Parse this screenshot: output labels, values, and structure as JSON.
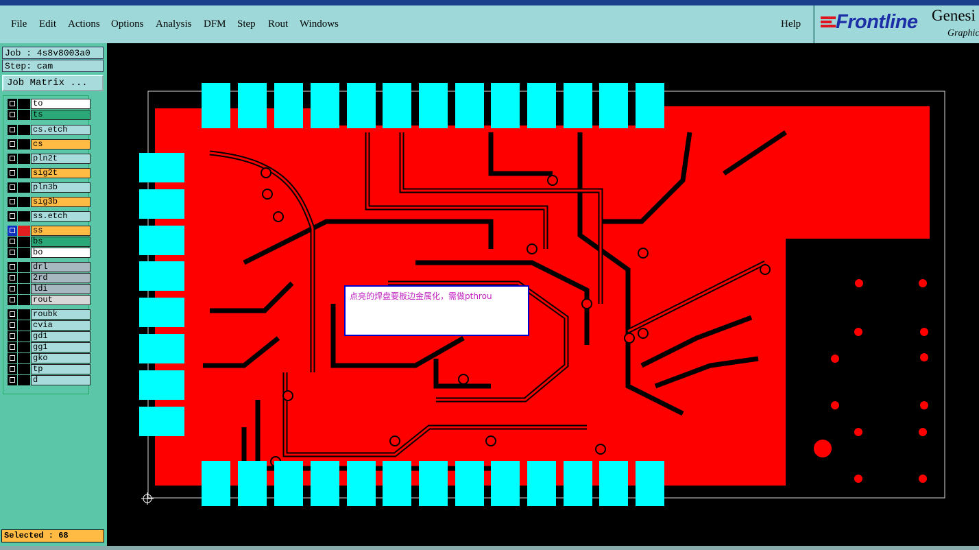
{
  "menu": {
    "items": [
      "File",
      "Edit",
      "Actions",
      "Options",
      "Analysis",
      "DFM",
      "Step",
      "Rout",
      "Windows"
    ],
    "help": "Help"
  },
  "logo": {
    "brand": "Frontline",
    "product": "Genesi",
    "sub": "Graphic"
  },
  "job": {
    "label": "Job : 4s8v8003a0",
    "step": "Step: cam",
    "matrix_button": "Job Matrix ..."
  },
  "layers": [
    {
      "name": "to",
      "color": "#ffffff"
    },
    {
      "name": "ts",
      "color": "#2aa878"
    },
    {
      "name": "cs.etch",
      "color": "#a8dcdc"
    },
    {
      "name": "cs",
      "color": "#ffbb44"
    },
    {
      "name": "pln2t",
      "color": "#a8dcdc"
    },
    {
      "name": "sig2t",
      "color": "#ffbb44"
    },
    {
      "name": "pln3b",
      "color": "#a8dcdc"
    },
    {
      "name": "sig3b",
      "color": "#ffbb44"
    },
    {
      "name": "ss.etch",
      "color": "#a8dcdc"
    },
    {
      "name": "ss",
      "color": "#ffbb44"
    },
    {
      "name": "bs",
      "color": "#2aa878"
    },
    {
      "name": "bo",
      "color": "#ffffff"
    },
    {
      "name": "drl",
      "color": "#a8b8c0"
    },
    {
      "name": "2rd",
      "color": "#a8b8c0"
    },
    {
      "name": "ldi",
      "color": "#a8b8c0"
    },
    {
      "name": "rout",
      "color": "#d8d8d8"
    },
    {
      "name": "roubk",
      "color": "#a8dcdc"
    },
    {
      "name": "cvia",
      "color": "#a8dcdc"
    },
    {
      "name": "gd1",
      "color": "#a8dcdc"
    },
    {
      "name": "gg1",
      "color": "#a8dcdc"
    },
    {
      "name": "gko",
      "color": "#a8dcdc"
    },
    {
      "name": "tp",
      "color": "#a8dcdc"
    },
    {
      "name": "d",
      "color": "#a8dcdc"
    }
  ],
  "status": {
    "selected": "Selected : 68"
  },
  "popup": {
    "text": "点亮的焊盘要板边金属化，需做pthrou"
  },
  "colors": {
    "copper": "#ff0000",
    "pad": "#00ffff",
    "background": "#000000"
  }
}
